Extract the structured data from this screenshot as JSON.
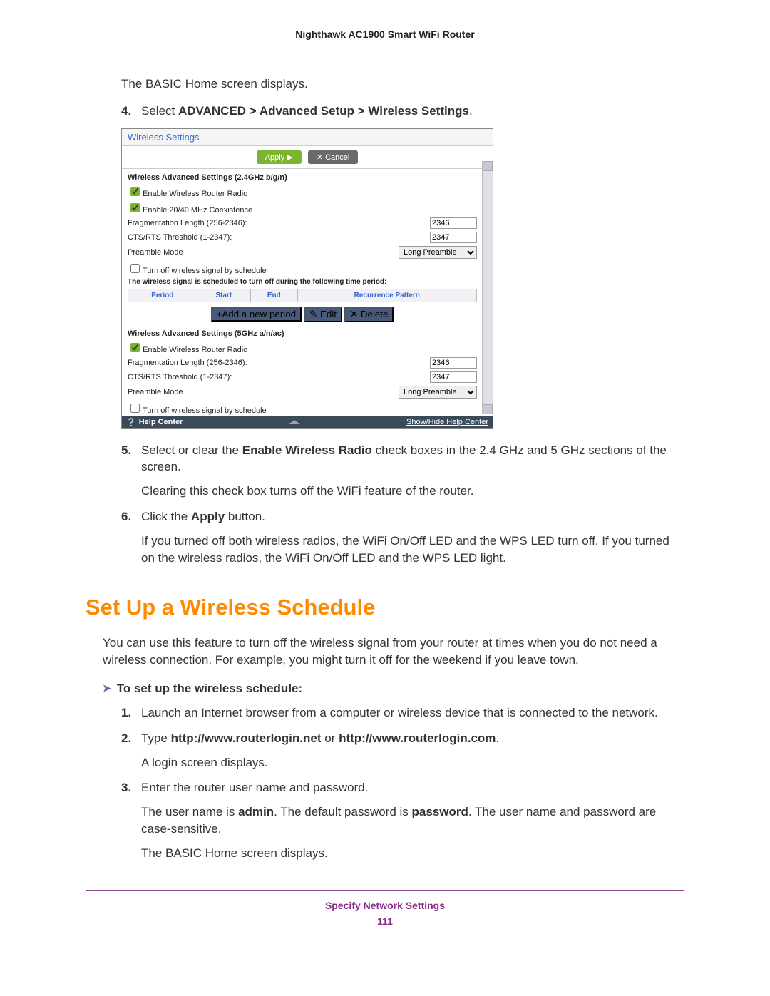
{
  "header": {
    "title": "Nighthawk AC1900 Smart WiFi Router"
  },
  "intro_text": "The BASIC Home screen displays.",
  "step4": {
    "num": "4.",
    "pre": "Select ",
    "bold": "ADVANCED > Advanced Setup > Wireless Settings",
    "post": "."
  },
  "router": {
    "title": "Wireless Settings",
    "apply": "Apply ▶",
    "cancel": "✕ Cancel",
    "sec24": {
      "title": "Wireless Advanced Settings (2.4GHz b/g/n)",
      "enable_radio": "Enable Wireless Router Radio",
      "enable_coex": "Enable 20/40 MHz Coexistence",
      "frag_label": "Fragmentation Length (256-2346):",
      "frag_val": "2346",
      "cts_label": "CTS/RTS Threshold (1-2347):",
      "cts_val": "2347",
      "preamble_label": "Preamble Mode",
      "preamble_val": "Long Preamble",
      "sched_off": "Turn off wireless signal by schedule",
      "sched_note": "The wireless signal is scheduled to turn off during the following time period:"
    },
    "sched_headers": {
      "period": "Period",
      "start": "Start",
      "end": "End",
      "pattern": "Recurrence Pattern"
    },
    "btn_add": "+Add a new period",
    "btn_edit": "✎ Edit",
    "btn_delete": "✕ Delete",
    "sec5": {
      "title": "Wireless Advanced Settings (5GHz a/n/ac)",
      "enable_radio": "Enable Wireless Router Radio",
      "frag_label": "Fragmentation Length (256-2346):",
      "frag_val": "2346",
      "cts_label": "CTS/RTS Threshold (1-2347):",
      "cts_val": "2347",
      "preamble_label": "Preamble Mode",
      "preamble_val": "Long Preamble",
      "sched_off": "Turn off wireless signal by schedule"
    },
    "help_center": "Help Center",
    "show_hide": "Show/Hide Help Center"
  },
  "step5": {
    "num": "5.",
    "pre": "Select or clear the ",
    "bold": "Enable Wireless Radio",
    "post": " check boxes in the 2.4 GHz and 5 GHz sections of the screen.",
    "sub": "Clearing this check box turns off the WiFi feature of the router."
  },
  "step6": {
    "num": "6.",
    "pre": "Click the ",
    "bold": "Apply",
    "post": " button.",
    "sub": "If you turned off both wireless radios, the WiFi On/Off LED and the WPS LED turn off. If you turned on the wireless radios, the WiFi On/Off LED and the WPS LED light."
  },
  "section_heading": "Set Up a Wireless Schedule",
  "section_intro": "You can use this feature to turn off the wireless signal from your router at times when you do not need a wireless connection. For example, you might turn it off for the weekend if you leave town.",
  "proc_heading": "To set up the wireless schedule:",
  "pstep1": {
    "num": "1.",
    "text": "Launch an Internet browser from a computer or wireless device that is connected to the network."
  },
  "pstep2": {
    "num": "2.",
    "pre": "Type ",
    "b1": "http://www.routerlogin.net",
    "mid": " or ",
    "b2": "http://www.routerlogin.com",
    "post": ".",
    "sub": "A login screen displays."
  },
  "pstep3": {
    "num": "3.",
    "text": "Enter the router user name and password.",
    "sub_pre": "The user name is ",
    "sub_b1": "admin",
    "sub_mid": ". The default password is ",
    "sub_b2": "password",
    "sub_post": ". The user name and password are case-sensitive.",
    "sub2": "The BASIC Home screen displays."
  },
  "footer": {
    "section": "Specify Network Settings",
    "page": "111"
  }
}
